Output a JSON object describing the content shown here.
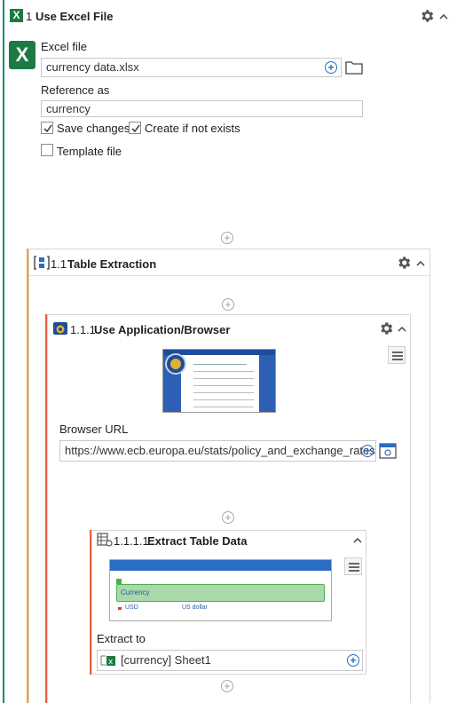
{
  "step1": {
    "number": "1",
    "title": "Use Excel File",
    "excel_file_label": "Excel file",
    "excel_file_value": "currency data.xlsx",
    "reference_label": "Reference as",
    "reference_value": "currency",
    "save_changes_label": "Save changes",
    "save_changes_checked": true,
    "create_label": "Create if not exists",
    "create_checked": true,
    "template_label": "Template file",
    "template_checked": false
  },
  "step11": {
    "number": "1.1",
    "title": "Table Extraction"
  },
  "step111": {
    "number": "1.1.1",
    "title": "Use Application/Browser",
    "url_label": "Browser URL",
    "url_value": "https://www.ecb.europa.eu/stats/policy_and_exchange_rates ..."
  },
  "step1111": {
    "number": "1.1.1.1",
    "title": "Extract Table Data",
    "preview_header": "Currency",
    "preview_code": "USD",
    "preview_name": "US dollar",
    "extract_label": "Extract to",
    "extract_value": "[currency] Sheet1"
  },
  "colors": {
    "excel_green": "#1e7a45",
    "accent_blue": "#2b6cc4",
    "line_orange": "#f0a030",
    "line_red": "#e8623a",
    "highlight_green": "#a9d9a9"
  }
}
